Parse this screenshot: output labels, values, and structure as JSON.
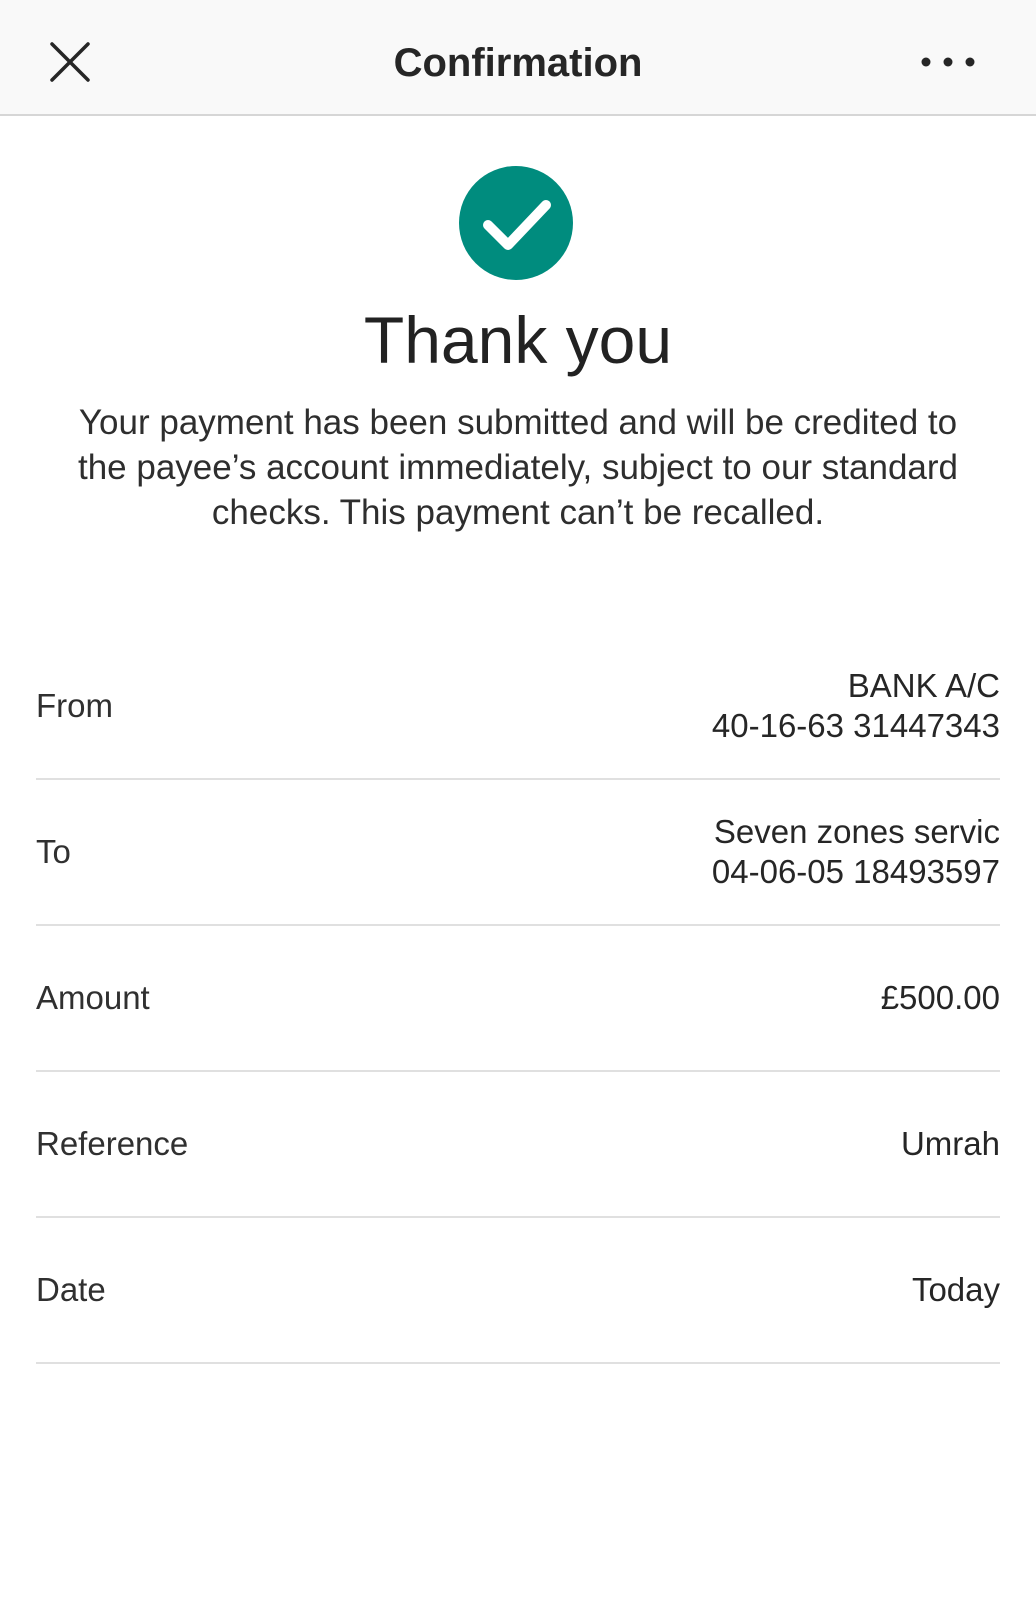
{
  "header": {
    "title": "Confirmation",
    "close_icon": "close-icon",
    "more_icon": "more-horizontal-icon"
  },
  "status": {
    "icon": "check-circle-icon",
    "icon_color": "#008C7E",
    "heading": "Thank you",
    "message": "Your payment has been submitted and will be credited to the payee’s account immediately, subject to our standard checks. This payment can’t be recalled."
  },
  "details": {
    "from": {
      "label": "From",
      "line1": "BANK A/C",
      "line2": "40-16-63 31447343"
    },
    "to": {
      "label": "To",
      "line1": "Seven zones servic",
      "line2": "04-06-05 18493597"
    },
    "amount": {
      "label": "Amount",
      "value": "£500.00"
    },
    "reference": {
      "label": "Reference",
      "value": "Umrah"
    },
    "date": {
      "label": "Date",
      "value": "Today"
    }
  }
}
